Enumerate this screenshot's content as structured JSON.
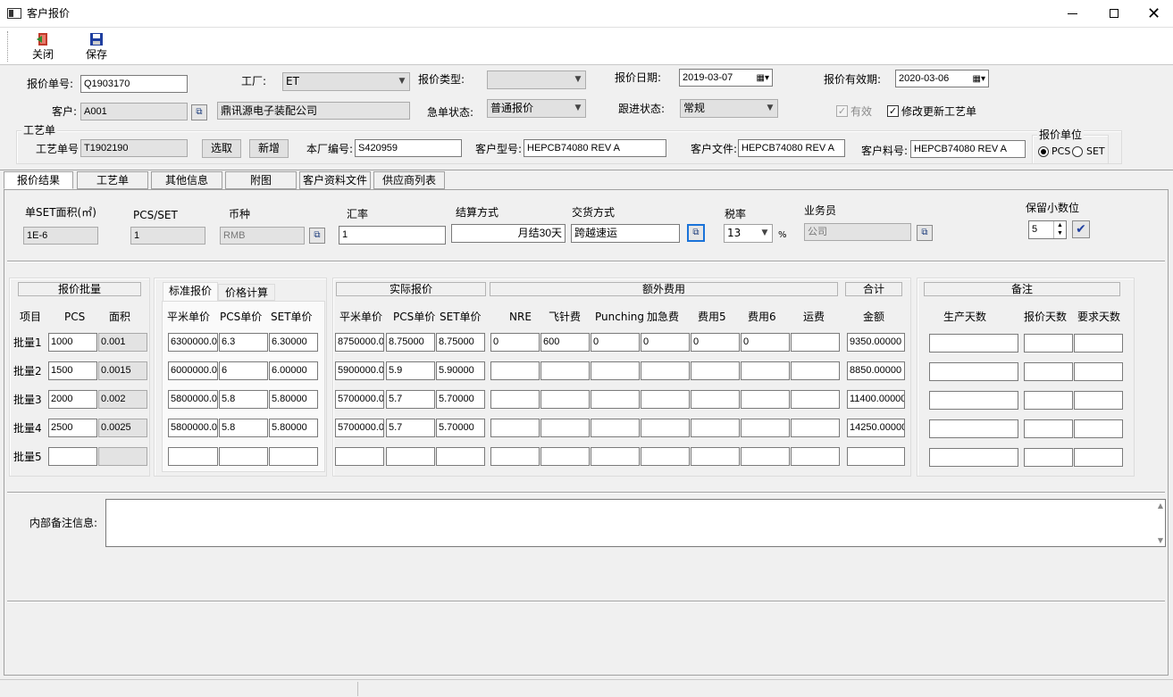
{
  "window": {
    "title": "客户报价"
  },
  "toolbar": {
    "close_label": "关闭",
    "save_label": "保存"
  },
  "header": {
    "quote_no_label": "报价单号:",
    "quote_no": "Q1903170",
    "factory_label": "工厂:",
    "factory": "ET",
    "quote_type_label": "报价类型:",
    "quote_type": "",
    "quote_date_label": "报价日期:",
    "quote_date": "2019-03-07",
    "valid_until_label": "报价有效期:",
    "valid_until": "2020-03-06",
    "customer_label": "客户:",
    "customer_code": "A001",
    "customer_name": "鼎讯源电子装配公司",
    "urgent_label": "急单状态:",
    "urgent": "普通报价",
    "follow_label": "跟进状态:",
    "follow": "常规",
    "valid_check_label": "有效",
    "update_craft_label": "修改更新工艺单",
    "craft_group_label": "工艺单",
    "craft_no_label": "工艺单号",
    "craft_no": "T1902190",
    "select_label": "选取",
    "new_label": "新增",
    "factory_no_label": "本厂编号:",
    "factory_no": "S420959",
    "cust_model_label": "客户型号:",
    "cust_model": "HEPCB74080 REV A",
    "cust_file_label": "客户文件:",
    "cust_file": "HEPCB74080 REV A",
    "cust_part_label": "客户料号:",
    "cust_part": "HEPCB74080 REV A",
    "unit_group_label": "报价单位",
    "unit_pcs": "PCS",
    "unit_set": "SET"
  },
  "tabs": [
    "报价结果",
    "工艺单",
    "其他信息",
    "附图",
    "客户资料文件",
    "供应商列表"
  ],
  "info": {
    "set_area_label": "单SET面积(㎡)",
    "set_area": "1E-6",
    "pcs_set_label": "PCS/SET",
    "pcs_set": "1",
    "currency_label": "币种",
    "currency": "RMB",
    "rate_label": "汇率",
    "rate": "1",
    "settle_label": "结算方式",
    "settle": "月结30天",
    "delivery_label": "交货方式",
    "delivery": "跨越速运",
    "tax_label": "税率",
    "tax": "13",
    "tax_unit": "%",
    "sales_label": "业务员",
    "sales": "公司",
    "decimals_label": "保留小数位",
    "decimals": "5"
  },
  "grid": {
    "batch_header": "报价批量",
    "std_tab": "标准报价",
    "calc_tab": "价格计算",
    "actual_header": "实际报价",
    "extra_header": "额外费用",
    "total_header": "合计",
    "remark_header": "备注",
    "cols": {
      "item": "项目",
      "pcs": "PCS",
      "area": "面积",
      "sqm_price": "平米单价",
      "pcs_price": "PCS单价",
      "set_price": "SET单价",
      "a_sqm_price": "平米单价",
      "a_pcs_price": "PCS单价",
      "a_set_price": "SET单价",
      "nre": "NRE",
      "fly": "飞针费",
      "punch": "Punching",
      "urgent": "加急费",
      "fee5": "费用5",
      "fee6": "费用6",
      "ship": "运费",
      "amount": "金额",
      "prod_days": "生产天数",
      "quote_days": "报价天数",
      "req_days": "要求天数"
    },
    "rows": [
      {
        "label": "批量1",
        "pcs": "1000",
        "area": "0.001",
        "sqm": "6300000.0",
        "pcs_price": "6.3",
        "set_price": "6.30000",
        "a_sqm": "8750000.0",
        "a_pcs": "8.75000",
        "a_set": "8.75000",
        "nre": "0",
        "fly": "600",
        "punch": "0",
        "urgent": "0",
        "fee5": "0",
        "fee6": "0",
        "ship": "",
        "amount": "9350.00000"
      },
      {
        "label": "批量2",
        "pcs": "1500",
        "area": "0.0015",
        "sqm": "6000000.0",
        "pcs_price": "6",
        "set_price": "6.00000",
        "a_sqm": "5900000.0",
        "a_pcs": "5.9",
        "a_set": "5.90000",
        "nre": "",
        "fly": "",
        "punch": "",
        "urgent": "",
        "fee5": "",
        "fee6": "",
        "ship": "",
        "amount": "8850.00000"
      },
      {
        "label": "批量3",
        "pcs": "2000",
        "area": "0.002",
        "sqm": "5800000.0",
        "pcs_price": "5.8",
        "set_price": "5.80000",
        "a_sqm": "5700000.0",
        "a_pcs": "5.7",
        "a_set": "5.70000",
        "nre": "",
        "fly": "",
        "punch": "",
        "urgent": "",
        "fee5": "",
        "fee6": "",
        "ship": "",
        "amount": "11400.00000"
      },
      {
        "label": "批量4",
        "pcs": "2500",
        "area": "0.0025",
        "sqm": "5800000.0",
        "pcs_price": "5.8",
        "set_price": "5.80000",
        "a_sqm": "5700000.0",
        "a_pcs": "5.7",
        "a_set": "5.70000",
        "nre": "",
        "fly": "",
        "punch": "",
        "urgent": "",
        "fee5": "",
        "fee6": "",
        "ship": "",
        "amount": "14250.00000"
      },
      {
        "label": "批量5",
        "pcs": "",
        "area": "",
        "sqm": "",
        "pcs_price": "",
        "set_price": "",
        "a_sqm": "",
        "a_pcs": "",
        "a_set": "",
        "nre": "",
        "fly": "",
        "punch": "",
        "urgent": "",
        "fee5": "",
        "fee6": "",
        "ship": "",
        "amount": ""
      }
    ]
  },
  "remarks": {
    "internal_label": "内部备注信息:",
    "internal": ""
  },
  "colors": {
    "titlebar": "#ffffff",
    "accent": "#0078d7",
    "window_bg": "#f0f0f0"
  }
}
